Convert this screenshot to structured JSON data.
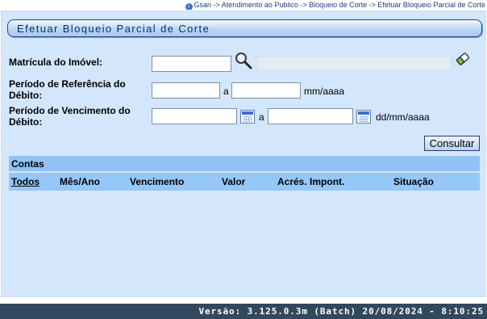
{
  "breadcrumb": {
    "text": "Gsan -> Atendimento ao Publico -> Bloqueio de Corte -> Efetuar Bloqueio Parcial de Corte"
  },
  "page": {
    "title": "Efetuar Bloqueio Parcial de Corte"
  },
  "form": {
    "matricula": {
      "label": "Matrícula do Imóvel:",
      "value": "",
      "description": "",
      "search_icon": "magnifier-icon",
      "clear_icon": "eraser-icon"
    },
    "periodo_referencia": {
      "label_line1": "Período de Referência do",
      "label_line2": "Débito:",
      "from_value": "",
      "separator": "a",
      "to_value": "",
      "format_hint": "mm/aaaa"
    },
    "periodo_vencimento": {
      "label_line1": "Período de Vencimento do",
      "label_line2": "Débito:",
      "from_value": "",
      "separator": "a",
      "to_value": "",
      "format_hint": "dd/mm/aaaa",
      "calendar_icon": "calendar-icon"
    },
    "consultar_label": "Consultar"
  },
  "contas": {
    "title": "Contas",
    "columns": [
      "Todos",
      "Mês/Ano",
      "Vencimento",
      "Valor",
      "Acrés. Impont.",
      "Situação"
    ],
    "rows": []
  },
  "footer": {
    "version": "Versão: 3.125.0.3m (Batch) 20/08/2024 - 8:10:25"
  },
  "colors": {
    "panel_bg": "#d3e6fb",
    "table_header_bg": "#90c2f7",
    "footer_bg": "#32485e"
  }
}
